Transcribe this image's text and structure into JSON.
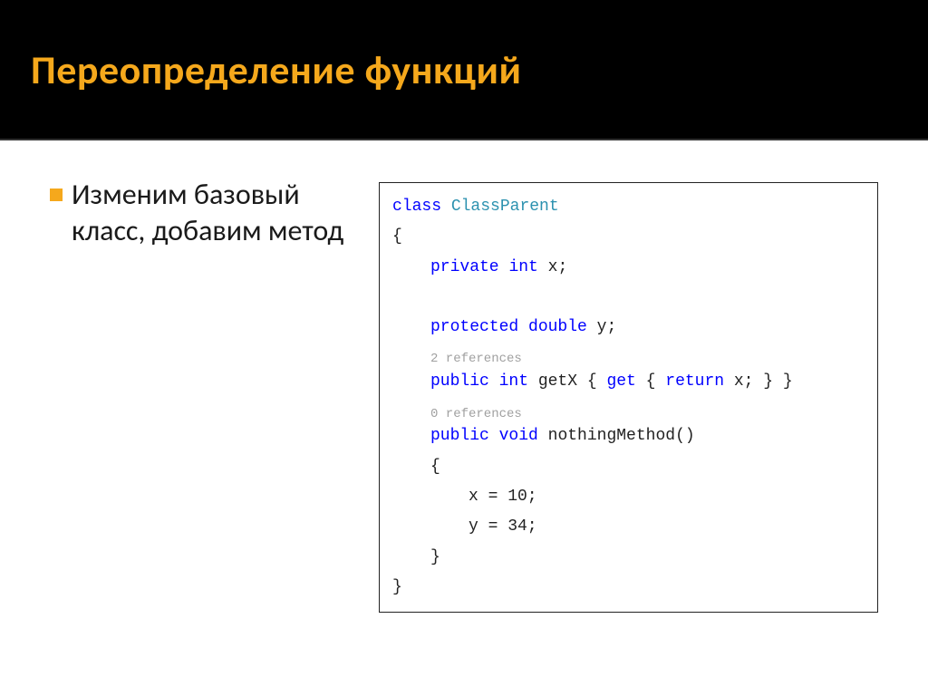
{
  "slide": {
    "title": "Переопределение функций",
    "bullet": "Изменим базовый класс, добавим метод",
    "code": {
      "kw_class": "class",
      "classname": "ClassParent",
      "obrace": "{",
      "kw_private": "private",
      "kw_int": "int",
      "var_x": " x;",
      "kw_protected": "protected",
      "kw_double": "double",
      "var_y": " y;",
      "ref2": "2 references",
      "kw_public1": "public",
      "kw_int2": "int",
      "getx": " getX { ",
      "kw_get": "get",
      "getx_mid": " { ",
      "kw_return": "return",
      "getx_tail": " x; } }",
      "ref0": "0 references",
      "kw_public2": "public",
      "kw_void": "void",
      "method": " nothingMethod()",
      "obrace2": "{",
      "body1": "x = 10;",
      "body2": "y = 34;",
      "cbrace2": "}",
      "cbrace": "}"
    }
  }
}
